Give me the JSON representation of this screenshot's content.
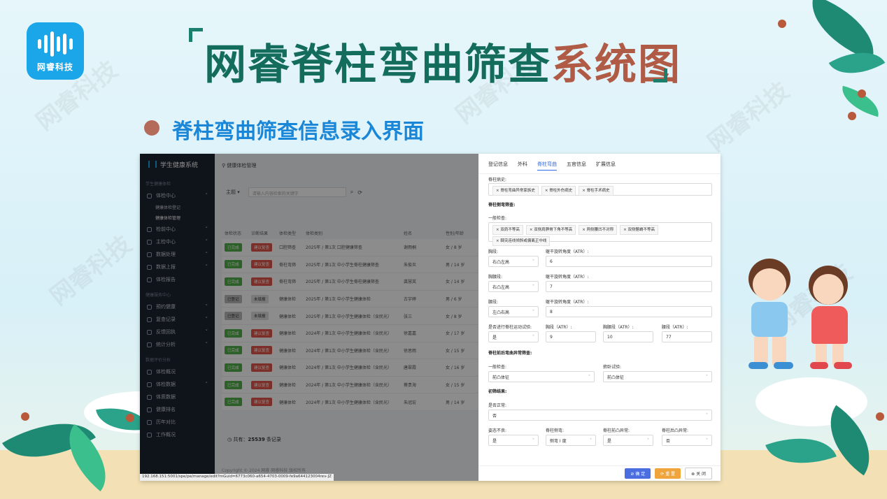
{
  "logo": {
    "text": "网睿科技"
  },
  "heading": {
    "part1": "网睿脊柱弯曲筛查",
    "part2": "系统图"
  },
  "subheading": "脊柱弯曲筛查信息录入界面",
  "app": {
    "brand": "学生健康系统",
    "sidebar": {
      "group1": "学生健康体检",
      "items1": [
        {
          "label": "体检中心"
        },
        {
          "label": "检前中心"
        },
        {
          "label": "主检中心"
        },
        {
          "label": "数据处理"
        },
        {
          "label": "数据上报"
        },
        {
          "label": "体检报告"
        }
      ],
      "subs": [
        "健康体检登记",
        "健康体检管理"
      ],
      "group2": "健康服务中心",
      "items2": [
        {
          "label": "预约健康"
        },
        {
          "label": "复查记录"
        },
        {
          "label": "反馈回执"
        },
        {
          "label": "统计分析"
        }
      ],
      "group3": "数据评价分析",
      "items3": [
        {
          "label": "体检概况"
        },
        {
          "label": "体检数据"
        },
        {
          "label": "体质数据"
        },
        {
          "label": "健康排名"
        },
        {
          "label": "历年对比"
        },
        {
          "label": "工作概况"
        }
      ]
    },
    "list": {
      "crumb": "健康体检管理",
      "select_label": "主题",
      "search_placeholder": "请输入内容检索的关键字",
      "headers": [
        "体检状态",
        "诊断结果",
        "体检类型",
        "体检类别",
        "姓名",
        "性别/年龄"
      ],
      "rows": [
        {
          "status": "已完成",
          "result": "建议复查",
          "type": "口腔筛查",
          "category": "2025年 / 第1次 口腔健康筛查",
          "name": "谢雨桐",
          "gender_age": "女 / 8 岁"
        },
        {
          "status": "已完成",
          "result": "建议复查",
          "type": "脊柱弯筛",
          "category": "2025年 / 第1次 中小学生脊柱健康筛查",
          "name": "朱俊炎",
          "gender_age": "男 / 14 岁"
        },
        {
          "status": "已完成",
          "result": "建议复查",
          "type": "脊柱弯筛",
          "category": "2025年 / 第1次 中小学生脊柱健康筛查",
          "name": "龚慧岚",
          "gender_age": "女 / 14 岁"
        },
        {
          "status": "已登记",
          "result": "未填报",
          "type": "健康体检",
          "category": "2025年 / 第1次 中小学生健康体检",
          "name": "古宇婷",
          "gender_age": "男 / 6 岁"
        },
        {
          "status": "已登记",
          "result": "未填报",
          "type": "健康体检",
          "category": "2025年 / 第1次 中小学生健康体检（含民光）",
          "name": "张三",
          "gender_age": "女 / 8 岁"
        },
        {
          "status": "已完成",
          "result": "建议复查",
          "type": "健康体检",
          "category": "2024年 / 第1次 中小学生健康体检（含民光）",
          "name": "徐嘉嘉",
          "gender_age": "女 / 17 岁"
        },
        {
          "status": "已完成",
          "result": "建议复查",
          "type": "健康体检",
          "category": "2024年 / 第1次 中小学生健康体检（含民光）",
          "name": "徐思雨",
          "gender_age": "女 / 15 岁"
        },
        {
          "status": "已完成",
          "result": "建议复查",
          "type": "健康体检",
          "category": "2024年 / 第1次 中小学生健康体检（含民光）",
          "name": "唐翠霞",
          "gender_age": "女 / 16 岁"
        },
        {
          "status": "已完成",
          "result": "建议复查",
          "type": "健康体检",
          "category": "2024年 / 第1次 中小学生健康体检（含民光）",
          "name": "蔡贵海",
          "gender_age": "女 / 15 岁"
        },
        {
          "status": "已完成",
          "result": "建议复查",
          "type": "健康体检",
          "category": "2024年 / 第1次 中小学生健康体检（含民光）",
          "name": "朱冠宏",
          "gender_age": "男 / 14 岁"
        }
      ],
      "total_label": "共有：",
      "total_value": "25539",
      "total_suffix": "条记录",
      "copyright": "Copyright © 2024 网睿 网睿科技 版权所有",
      "url": "192.168.151:5001/spe/pe/manage/edit?mGuid=6773c060-a654-4703-0009-fe9a644123004rev-JZ"
    },
    "form": {
      "tabs": [
        "登记信息",
        "外科",
        "脊柱弯曲",
        "五官信息",
        "扩展信息"
      ],
      "history_label": "脊柱病史:",
      "history_chips": [
        "脊柱弯曲异常家族史",
        "脊柱外伤病史",
        "脊柱手术病史"
      ],
      "section1": "脊柱侧弯筛查:",
      "general_label": "一般检查:",
      "general_chips": [
        "双肩不等高",
        "双侧肩胛骨下角不等高",
        "两侧腰凹不对称",
        "双侧髂嵴不等高",
        "棘突连线倾斜或偏离正中线"
      ],
      "chest_label": "胸段:",
      "chest_value": "右凸左高",
      "chest_atr_label": "躯干旋转角度（ATR）:",
      "chest_atr": "6",
      "thoracolumbar_label": "胸腰段:",
      "thoracolumbar_value": "右凸左高",
      "thoracolumbar_atr_label": "躯干旋转角度（ATR）:",
      "thoracolumbar_atr": "7",
      "lumbar_label": "腰段:",
      "lumbar_value": "左凸右高",
      "lumbar_atr_label": "躯干旋转角度（ATR）:",
      "lumbar_atr": "8",
      "motion_label": "是否进行脊柱运动试验:",
      "motion_value": "是",
      "chest2_label": "胸段（ATR）:",
      "chest2_value": "9",
      "tl2_label": "胸腰段（ATR）:",
      "tl2_value": "10",
      "lumbar2_label": "腰段（ATR）:",
      "lumbar2_value": "77",
      "section2": "脊柱前后弯曲异常筛查:",
      "general2_label": "一般检查:",
      "general2_value": "前凸体征",
      "prone_label": "俯卧试验:",
      "prone_value": "前凸体征",
      "section3": "初筛结果:",
      "normal_label": "是否正常:",
      "normal_value": "否",
      "posture_label": "姿态不良:",
      "posture_value": "是",
      "side_label": "脊柱侧弯:",
      "side_value": "侧弯 I 度",
      "front_label": "脊柱前凸异常:",
      "front_value": "是",
      "back_label": "脊柱后凸异常:",
      "back_value": "否",
      "btn_ok": "确 定",
      "btn_reset": "重 置",
      "btn_close": "关 闭"
    }
  },
  "watermark": "网睿科技",
  "colors": {
    "title_green": "#136c5c",
    "title_brown": "#b05b46",
    "sub_blue": "#1a86d8",
    "accent": "#2e6be6"
  }
}
